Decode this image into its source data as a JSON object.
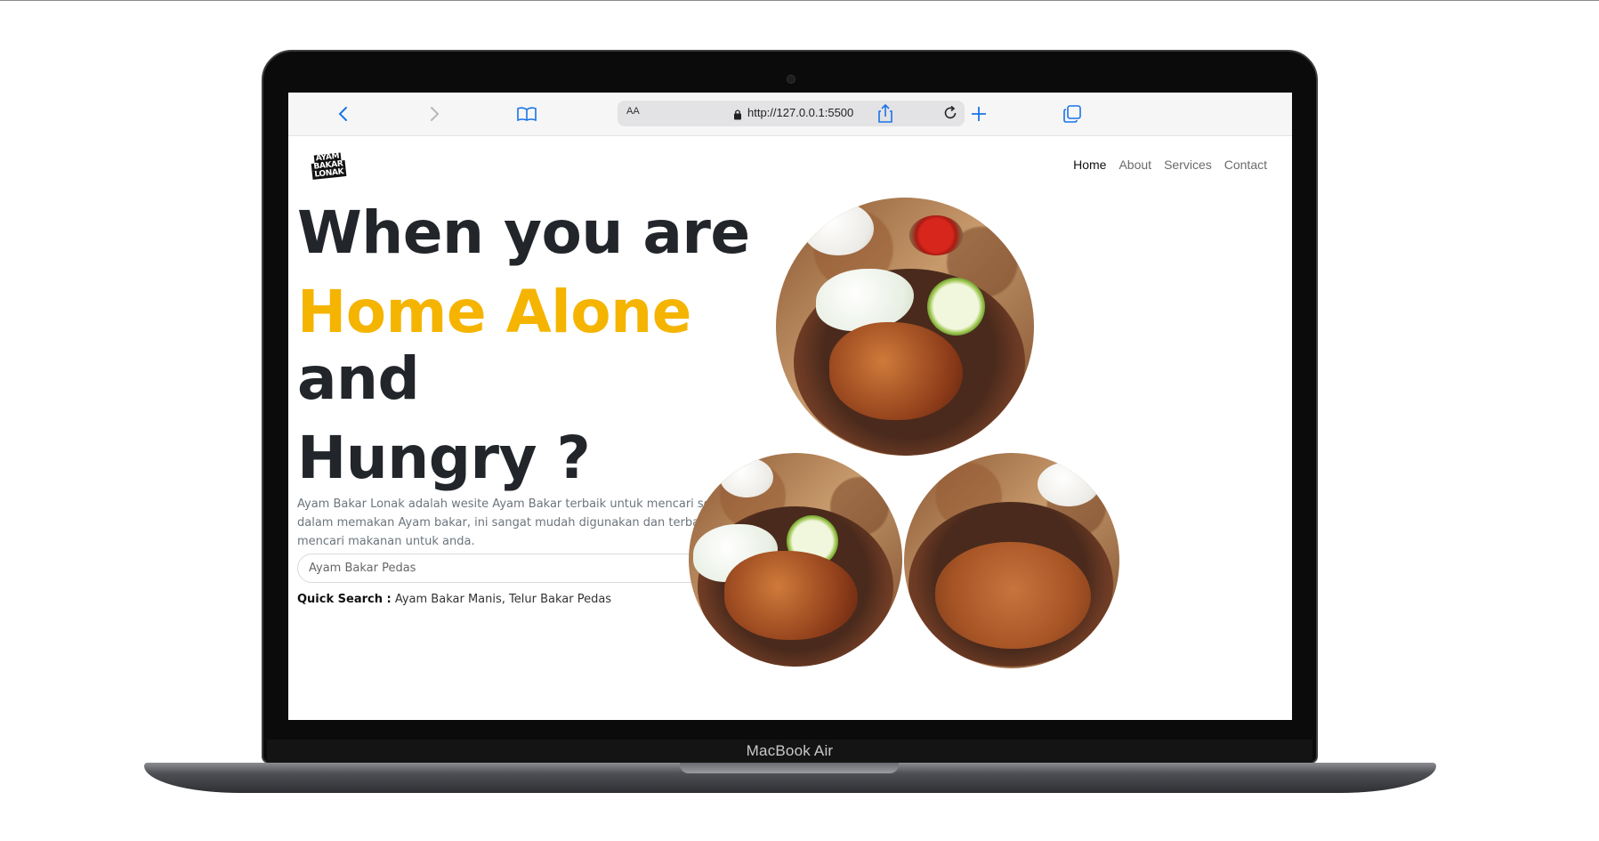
{
  "device": {
    "model_label": "MacBook Air"
  },
  "browser": {
    "text_size_label": "AA",
    "url": "http://127.0.0.1:5500",
    "icons": [
      "chevron-left-icon",
      "chevron-right-icon",
      "book-icon",
      "lock-icon",
      "reload-icon",
      "share-icon",
      "plus-icon",
      "tabs-icon"
    ]
  },
  "site": {
    "logo": {
      "lines": [
        "AYAM",
        "BAKAR",
        "LONAK"
      ]
    },
    "nav": {
      "items": [
        {
          "label": "Home",
          "active": true
        },
        {
          "label": "About",
          "active": false
        },
        {
          "label": "Services",
          "active": false
        },
        {
          "label": "Contact",
          "active": false
        }
      ]
    },
    "hero": {
      "line1": "When you are",
      "line2": "Home Alone",
      "line3": "and",
      "line4": "Hungry ?",
      "description": "Ayam Bakar Lonak adalah wesite Ayam Bakar terbaik untuk mencari sensasi baru dalam memakan Ayam bakar, ini sangat mudah digunakan dan terbaik dalam mencari makanan untuk anda.",
      "search": {
        "placeholder": "Ayam Bakar Pedas",
        "button_icon": "search-icon"
      },
      "quick_search": {
        "label": "Quick Search :",
        "items": "Ayam Bakar Manis, Telur Bakar Pedas"
      }
    },
    "colors": {
      "accent": "#f4b400",
      "heading": "#22252a",
      "muted": "#6c757d"
    }
  }
}
